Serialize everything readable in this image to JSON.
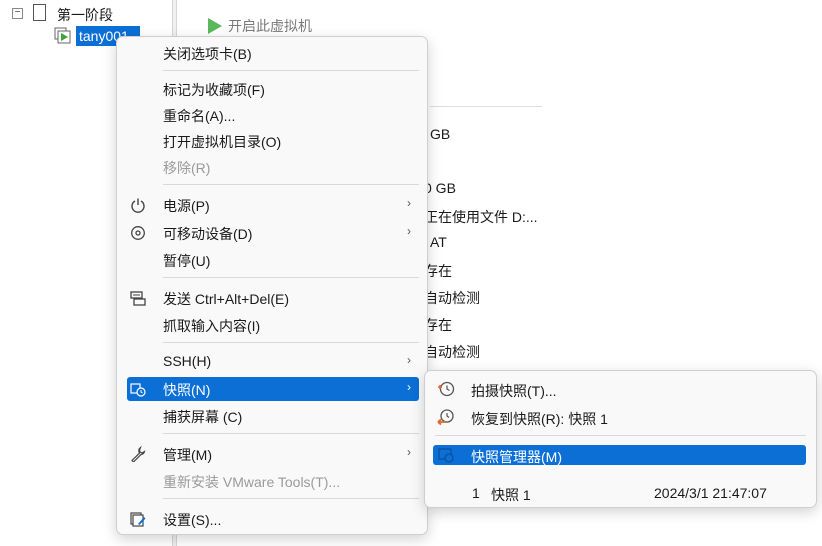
{
  "tree": {
    "expander": "−",
    "group_label": "第一阶段",
    "vm_label": "tany001"
  },
  "content": {
    "start_vm": "开启此虚拟机",
    "info_lines": [
      "GB",
      "0 GB",
      "正在使用文件 D:...",
      "AT",
      "存在",
      "自动检测",
      "存在",
      "自动检测"
    ]
  },
  "menu": {
    "close_tab": "关闭选项卡(B)",
    "favorite": "标记为收藏项(F)",
    "rename": "重命名(A)...",
    "open_dir": "打开虚拟机目录(O)",
    "remove": "移除(R)",
    "power": "电源(P)",
    "removable": "可移动设备(D)",
    "pause": "暂停(U)",
    "send_cad": "发送 Ctrl+Alt+Del(E)",
    "grab_input": "抓取输入内容(I)",
    "ssh": "SSH(H)",
    "snapshot": "快照(N)",
    "capture_screen": "捕获屏幕 (C)",
    "manage": "管理(M)",
    "reinstall_tools": "重新安装 VMware Tools(T)...",
    "settings": "设置(S)...",
    "submenu_arrow": "›"
  },
  "submenu": {
    "take_snapshot": "拍摄快照(T)...",
    "revert_snapshot": "恢复到快照(R): 快照 1",
    "snapshot_manager": "快照管理器(M)",
    "snapshots": [
      {
        "index": "1",
        "name": "快照 1",
        "date": "2024/3/1 21:47:07"
      }
    ]
  },
  "colors": {
    "highlight": "#0b6fd6",
    "menu_bg": "#f9f9f9",
    "disabled_text": "#9a9a9a",
    "play_green": "#5cb85c"
  }
}
